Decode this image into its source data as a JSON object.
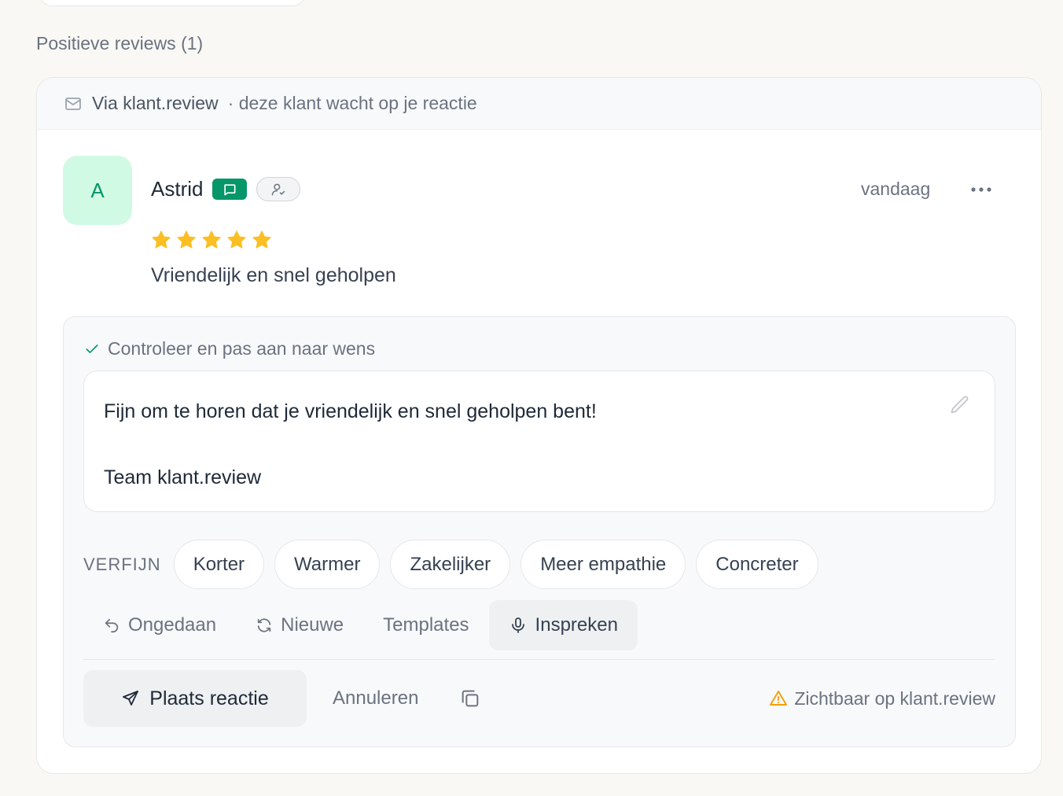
{
  "section": {
    "title": "Positieve reviews (1)"
  },
  "card": {
    "source_label": "Via klant.review",
    "status_text": "· deze klant wacht op je reactie",
    "source_icon": "mail-icon"
  },
  "review": {
    "avatar_initial": "A",
    "name": "Astrid",
    "date": "vandaag",
    "rating": 5,
    "rating_max": 5,
    "text": "Vriendelijk en snel geholpen"
  },
  "reply": {
    "check_label": "Controleer en pas aan naar wens",
    "line1": "Fijn om te horen dat je vriendelijk en snel geholpen bent!",
    "line2": "Team klant.review"
  },
  "refine": {
    "label": "VERFIJN",
    "chips": [
      "Korter",
      "Warmer",
      "Zakelijker",
      "Meer empathie",
      "Concreter"
    ]
  },
  "tools": {
    "undo": "Ongedaan",
    "new": "Nieuwe",
    "templates": "Templates",
    "dictate": "Inspreken"
  },
  "actions": {
    "post": "Plaats reactie",
    "cancel": "Annuleren",
    "visibility": "Zichtbaar op klant.review"
  },
  "colors": {
    "accent_green": "#059669",
    "avatar_bg": "#d1fae5",
    "star": "#fbbf24",
    "warning": "#f59e0b"
  }
}
